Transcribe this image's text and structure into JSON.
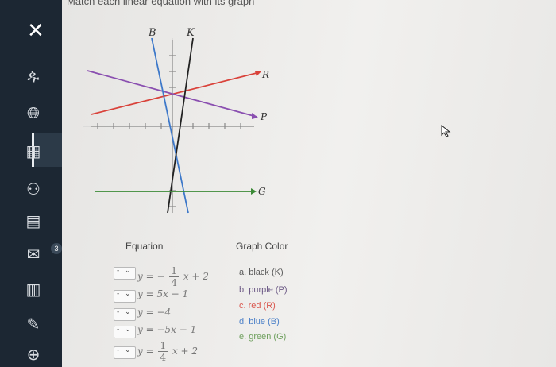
{
  "header": {
    "title": "Match each linear equation with its graph"
  },
  "sidebar": {
    "icons": [
      "close-icon",
      "user-avatar-icon",
      "globe-icon",
      "calculator-icon",
      "people-icon",
      "calendar-icon",
      "mail-icon",
      "book-icon",
      "edit-icon",
      "help-icon"
    ],
    "badge": "3"
  },
  "graph": {
    "labels": {
      "B": "B",
      "K": "K",
      "R": "R",
      "P": "P",
      "G": "G"
    },
    "colors": {
      "black": "#222222",
      "purple": "#8a4fb0",
      "red": "#d9423a",
      "blue": "#3d78c9",
      "green": "#3b8a36"
    }
  },
  "equations": {
    "header": "Equation",
    "rows": [
      {
        "pre": "y =",
        "neg": "−",
        "num": "1",
        "den": "4",
        "post": "x + 2"
      },
      {
        "text": "y = 5x − 1"
      },
      {
        "text": "y = −4"
      },
      {
        "text": "y = −5x − 1"
      },
      {
        "pre": "y =",
        "neg": "",
        "num": "1",
        "den": "4",
        "post": "x + 2"
      }
    ]
  },
  "options": {
    "header": "Graph Color",
    "items": [
      {
        "text": "a. black (K)",
        "color": "#5a5a5a"
      },
      {
        "text": "b. purple (P)",
        "color": "#6d5a86"
      },
      {
        "text": "c. red (R)",
        "color": "#d9554c"
      },
      {
        "text": "d. blue (B)",
        "color": "#4a7fc8"
      },
      {
        "text": "e. green (G)",
        "color": "#6fa05e"
      }
    ]
  },
  "dropdown": {
    "arrow": "⌄",
    "dash": "-"
  }
}
